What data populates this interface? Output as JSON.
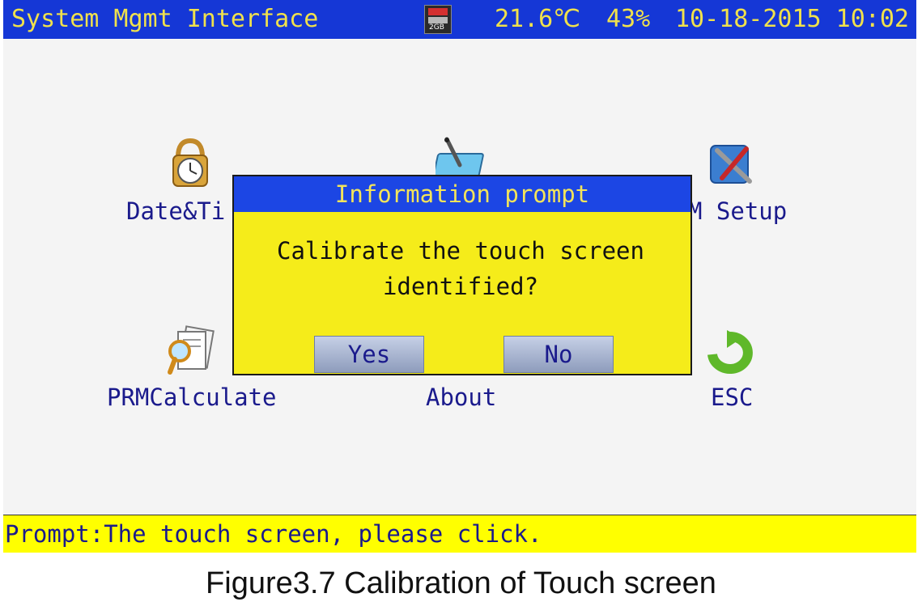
{
  "topbar": {
    "title": "System Mgmt Interface",
    "sd_card_label": "2GB",
    "sd_icon": "sd-card-icon",
    "temperature": "21.6℃",
    "humidity": "43%",
    "datetime": "10-18-2015 10:02"
  },
  "menu": {
    "date_time": {
      "label": "Date&Ti",
      "icon": "clock-lock-icon"
    },
    "touch": {
      "icon": "touch-screen-pen-icon"
    },
    "prm_setup": {
      "label": "M Setup",
      "icon": "tools-icon"
    },
    "prm_calculate": {
      "label": "PRMCalculate",
      "icon": "magnifier-document-icon"
    },
    "about": {
      "label": "About"
    },
    "esc": {
      "label": "ESC",
      "icon": "return-arrow-icon"
    }
  },
  "modal": {
    "title": "Information prompt",
    "message_line1": "Calibrate the touch screen",
    "message_line2": "identified?",
    "yes_label": "Yes",
    "no_label": "No"
  },
  "status": {
    "prompt": "Prompt:The touch screen, please click."
  },
  "caption": "Figure3.7 Calibration of Touch screen",
  "colors": {
    "titlebar_bg": "#1537d6",
    "titlebar_text": "#f0e14c",
    "menu_text": "#1a1a8c",
    "modal_bg": "#f5ec1a",
    "modal_header_bg": "#1c46e4",
    "status_bg": "#ffff00"
  }
}
